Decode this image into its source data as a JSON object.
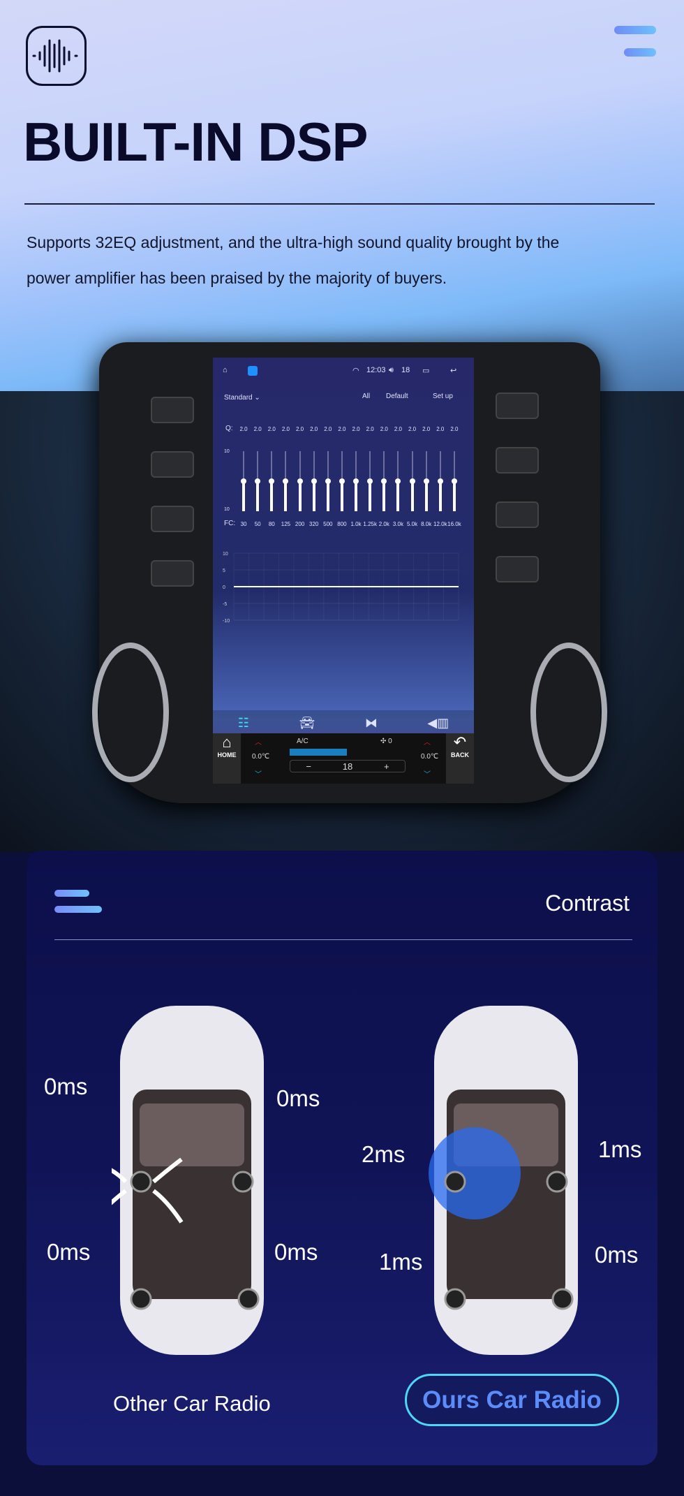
{
  "header": {
    "title": "BUILT-IN DSP",
    "description_line1": "Supports 32EQ adjustment, and the ultra-high sound quality brought by the",
    "description_line2": "power amplifier has been praised by the majority of buyers.",
    "logo_icon": "sound-wave-icon",
    "menu_icon": "hamburger-icon"
  },
  "screen": {
    "status": {
      "time": "12:03",
      "volume": "18"
    },
    "preset": "Standard",
    "actions": [
      "All",
      "Default",
      "Set up"
    ],
    "q_label": "Q:",
    "q_values": [
      "2.0",
      "2.0",
      "2.0",
      "2.0",
      "2.0",
      "2.0",
      "2.0",
      "2.0",
      "2.0",
      "2.0",
      "2.0",
      "2.0",
      "2.0",
      "2.0",
      "2.0",
      "2.0"
    ],
    "fc_label": "FC:",
    "fc_values": [
      "30",
      "50",
      "80",
      "125",
      "200",
      "320",
      "500",
      "800",
      "1.0k",
      "1.25k",
      "2.0k",
      "3.0k",
      "5.0k",
      "8.0k",
      "12.0k",
      "16.0k"
    ],
    "slider_scale": [
      "10",
      "10"
    ],
    "gains_db": [
      0,
      0,
      0,
      0,
      0,
      0,
      0,
      0,
      0,
      0,
      0,
      0,
      0,
      0,
      0,
      0
    ],
    "curve_ticks": [
      "10",
      "5",
      "0",
      "-5",
      "-10"
    ],
    "bottom_tabs": [
      "equalizer-icon",
      "car-speaker-icon",
      "balance-icon",
      "sound-field-icon"
    ]
  },
  "climate": {
    "home": "HOME",
    "back": "BACK",
    "ac": "A/C",
    "fan": "0",
    "temp_left": "0.0℃",
    "temp_right": "0.0℃",
    "set_temp": "18",
    "minus": "−",
    "plus": "+"
  },
  "contrast": {
    "title": "Contrast",
    "other": {
      "label": "Other Car Radio",
      "delays": [
        "0ms",
        "0ms",
        "0ms",
        "0ms"
      ]
    },
    "ours": {
      "label": "Ours Car Radio",
      "delays": [
        "2ms",
        "1ms",
        "1ms",
        "0ms"
      ]
    }
  },
  "colors": {
    "accent": "#4fd6f4",
    "title": "#0a0a2a",
    "card": "#0c0f4a"
  }
}
